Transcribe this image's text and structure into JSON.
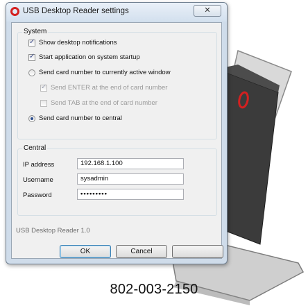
{
  "window": {
    "title": "USB Desktop Reader settings",
    "close_glyph": "✕"
  },
  "system": {
    "group_label": "System",
    "options": [
      {
        "label": "Show desktop notifications",
        "kind": "checkbox",
        "checked": true,
        "enabled": true
      },
      {
        "label": "Start application on system startup",
        "kind": "checkbox",
        "checked": true,
        "enabled": true
      },
      {
        "label": "Send card number to currently active window",
        "kind": "radio",
        "checked": false,
        "enabled": true
      },
      {
        "label": "Send ENTER at the end of card number",
        "kind": "checkbox",
        "checked": true,
        "enabled": false
      },
      {
        "label": "Send TAB at the end of card number",
        "kind": "checkbox",
        "checked": false,
        "enabled": false
      },
      {
        "label": "Send card number to central",
        "kind": "radio",
        "checked": true,
        "enabled": true
      }
    ]
  },
  "central": {
    "group_label": "Central",
    "ip_label": "IP address",
    "ip_value": "192.168.1.100",
    "username_label": "Username",
    "username_value": "sysadmin",
    "password_label": "Password",
    "password_value": "•••••••••"
  },
  "footer": {
    "version": "USB Desktop Reader 1.0",
    "ok_label": "OK",
    "cancel_label": "Cancel",
    "apply_label": ""
  },
  "part_number": "802-003-2150",
  "colors": {
    "accent_red": "#d42020",
    "device_body": "#3a3a3a",
    "stand_glass": "#a9a9a9"
  }
}
